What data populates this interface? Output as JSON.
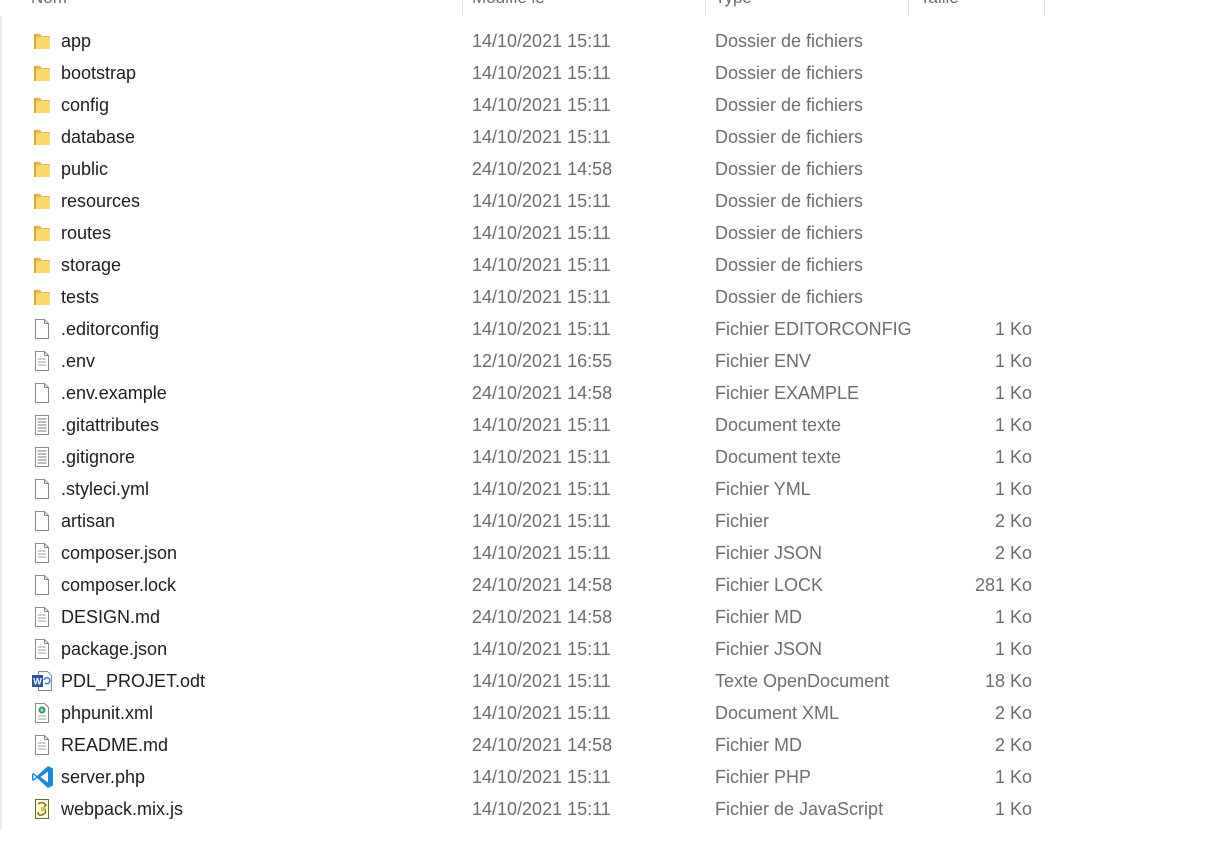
{
  "columns": {
    "name": "Nom",
    "modified": "Modifié le",
    "type": "Type",
    "size": "Taille"
  },
  "files": [
    {
      "name": "app",
      "date": "14/10/2021 15:11",
      "type": "Dossier de fichiers",
      "size": "",
      "icon": "folder-icon"
    },
    {
      "name": "bootstrap",
      "date": "14/10/2021 15:11",
      "type": "Dossier de fichiers",
      "size": "",
      "icon": "folder-icon"
    },
    {
      "name": "config",
      "date": "14/10/2021 15:11",
      "type": "Dossier de fichiers",
      "size": "",
      "icon": "folder-icon"
    },
    {
      "name": "database",
      "date": "14/10/2021 15:11",
      "type": "Dossier de fichiers",
      "size": "",
      "icon": "folder-icon"
    },
    {
      "name": "public",
      "date": "24/10/2021 14:58",
      "type": "Dossier de fichiers",
      "size": "",
      "icon": "folder-icon"
    },
    {
      "name": "resources",
      "date": "14/10/2021 15:11",
      "type": "Dossier de fichiers",
      "size": "",
      "icon": "folder-icon"
    },
    {
      "name": "routes",
      "date": "14/10/2021 15:11",
      "type": "Dossier de fichiers",
      "size": "",
      "icon": "folder-icon"
    },
    {
      "name": "storage",
      "date": "14/10/2021 15:11",
      "type": "Dossier de fichiers",
      "size": "",
      "icon": "folder-icon"
    },
    {
      "name": "tests",
      "date": "14/10/2021 15:11",
      "type": "Dossier de fichiers",
      "size": "",
      "icon": "folder-icon"
    },
    {
      "name": ".editorconfig",
      "date": "14/10/2021 15:11",
      "type": "Fichier EDITORCONFIG",
      "size": "1 Ko",
      "icon": "blank-file-icon"
    },
    {
      "name": ".env",
      "date": "12/10/2021 16:55",
      "type": "Fichier ENV",
      "size": "1 Ko",
      "icon": "lined-file-icon"
    },
    {
      "name": ".env.example",
      "date": "24/10/2021 14:58",
      "type": "Fichier EXAMPLE",
      "size": "1 Ko",
      "icon": "blank-file-icon"
    },
    {
      "name": ".gitattributes",
      "date": "14/10/2021 15:11",
      "type": "Document texte",
      "size": "1 Ko",
      "icon": "text-file-icon"
    },
    {
      "name": ".gitignore",
      "date": "14/10/2021 15:11",
      "type": "Document texte",
      "size": "1 Ko",
      "icon": "text-file-icon"
    },
    {
      "name": ".styleci.yml",
      "date": "14/10/2021 15:11",
      "type": "Fichier YML",
      "size": "1 Ko",
      "icon": "blank-file-icon"
    },
    {
      "name": "artisan",
      "date": "14/10/2021 15:11",
      "type": "Fichier",
      "size": "2 Ko",
      "icon": "blank-file-icon"
    },
    {
      "name": "composer.json",
      "date": "14/10/2021 15:11",
      "type": "Fichier JSON",
      "size": "2 Ko",
      "icon": "lined-file-icon"
    },
    {
      "name": "composer.lock",
      "date": "24/10/2021 14:58",
      "type": "Fichier LOCK",
      "size": "281 Ko",
      "icon": "blank-file-icon"
    },
    {
      "name": "DESIGN.md",
      "date": "24/10/2021 14:58",
      "type": "Fichier MD",
      "size": "1 Ko",
      "icon": "lined-file-icon"
    },
    {
      "name": "package.json",
      "date": "14/10/2021 15:11",
      "type": "Fichier JSON",
      "size": "1 Ko",
      "icon": "lined-file-icon"
    },
    {
      "name": "PDL_PROJET.odt",
      "date": "14/10/2021 15:11",
      "type": "Texte OpenDocument",
      "size": "18 Ko",
      "icon": "word-document-icon"
    },
    {
      "name": "phpunit.xml",
      "date": "14/10/2021 15:11",
      "type": "Document XML",
      "size": "2 Ko",
      "icon": "xml-file-icon"
    },
    {
      "name": "README.md",
      "date": "24/10/2021 14:58",
      "type": "Fichier MD",
      "size": "2 Ko",
      "icon": "lined-file-icon"
    },
    {
      "name": "server.php",
      "date": "14/10/2021 15:11",
      "type": "Fichier PHP",
      "size": "1 Ko",
      "icon": "vscode-icon"
    },
    {
      "name": "webpack.mix.js",
      "date": "14/10/2021 15:11",
      "type": "Fichier de JavaScript",
      "size": "1 Ko",
      "icon": "javascript-file-icon"
    }
  ],
  "colors": {
    "folder": "#f8d775",
    "folder_dark": "#e8b84a",
    "vscode_blue": "#1a8ad4",
    "word_blue": "#2b579a"
  }
}
